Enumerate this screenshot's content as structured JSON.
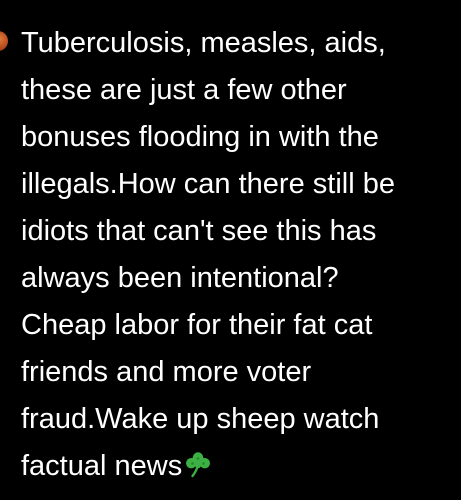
{
  "tweet": {
    "lines": [
      "Tuberculosis, measles, aids,",
      "these are just a few other",
      "bonuses flooding in with the",
      "illegals.How can there still be",
      "idiots that can't see this has",
      "always been intentional?",
      "Cheap labor for their fat cat",
      "friends and more voter",
      "fraud.Wake up sheep watch",
      "factual news"
    ],
    "emoji": "shamrock-icon"
  },
  "colors": {
    "background": "#000000",
    "text": "#ffffff",
    "shamrock": "#3cb043"
  }
}
